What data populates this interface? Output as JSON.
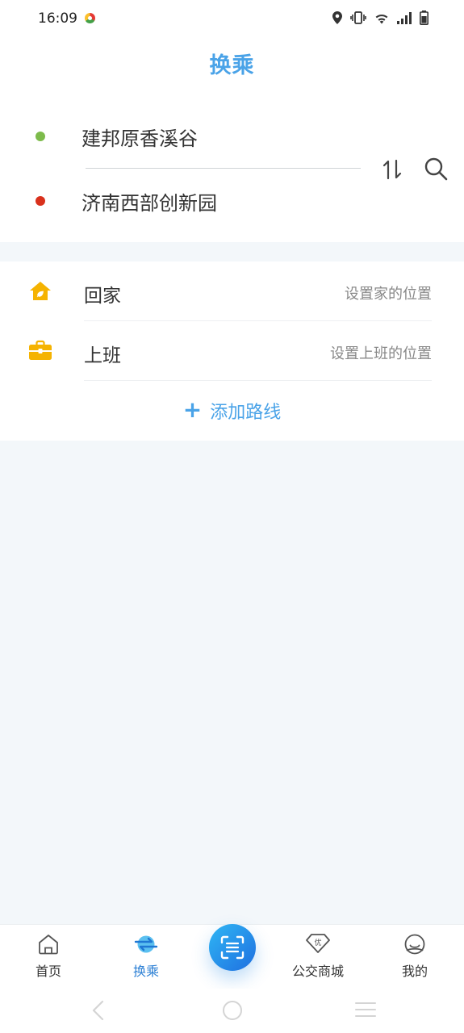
{
  "status_bar": {
    "time": "16:09"
  },
  "header": {
    "title": "换乘"
  },
  "route": {
    "start": "建邦原香溪谷",
    "end": "济南西部创新园"
  },
  "favorites": [
    {
      "label": "回家",
      "hint": "设置家的位置",
      "icon": "home-icon"
    },
    {
      "label": "上班",
      "hint": "设置上班的位置",
      "icon": "briefcase-icon"
    }
  ],
  "add_route": {
    "plus": "+",
    "label": "添加路线"
  },
  "bottom_nav": {
    "items": [
      {
        "label": "首页",
        "icon": "home-outline-icon"
      },
      {
        "label": "换乘",
        "icon": "transfer-icon",
        "active": true
      },
      {
        "label": "",
        "icon": "scan-icon"
      },
      {
        "label": "公交商城",
        "icon": "mall-diamond-icon"
      },
      {
        "label": "我的",
        "icon": "profile-icon"
      }
    ]
  },
  "colors": {
    "accent": "#4aa3e8",
    "start_dot": "#7dbb4b",
    "end_dot": "#d9311c",
    "fav_icon": "#f5b301",
    "active_nav": "#2b7fd4"
  }
}
